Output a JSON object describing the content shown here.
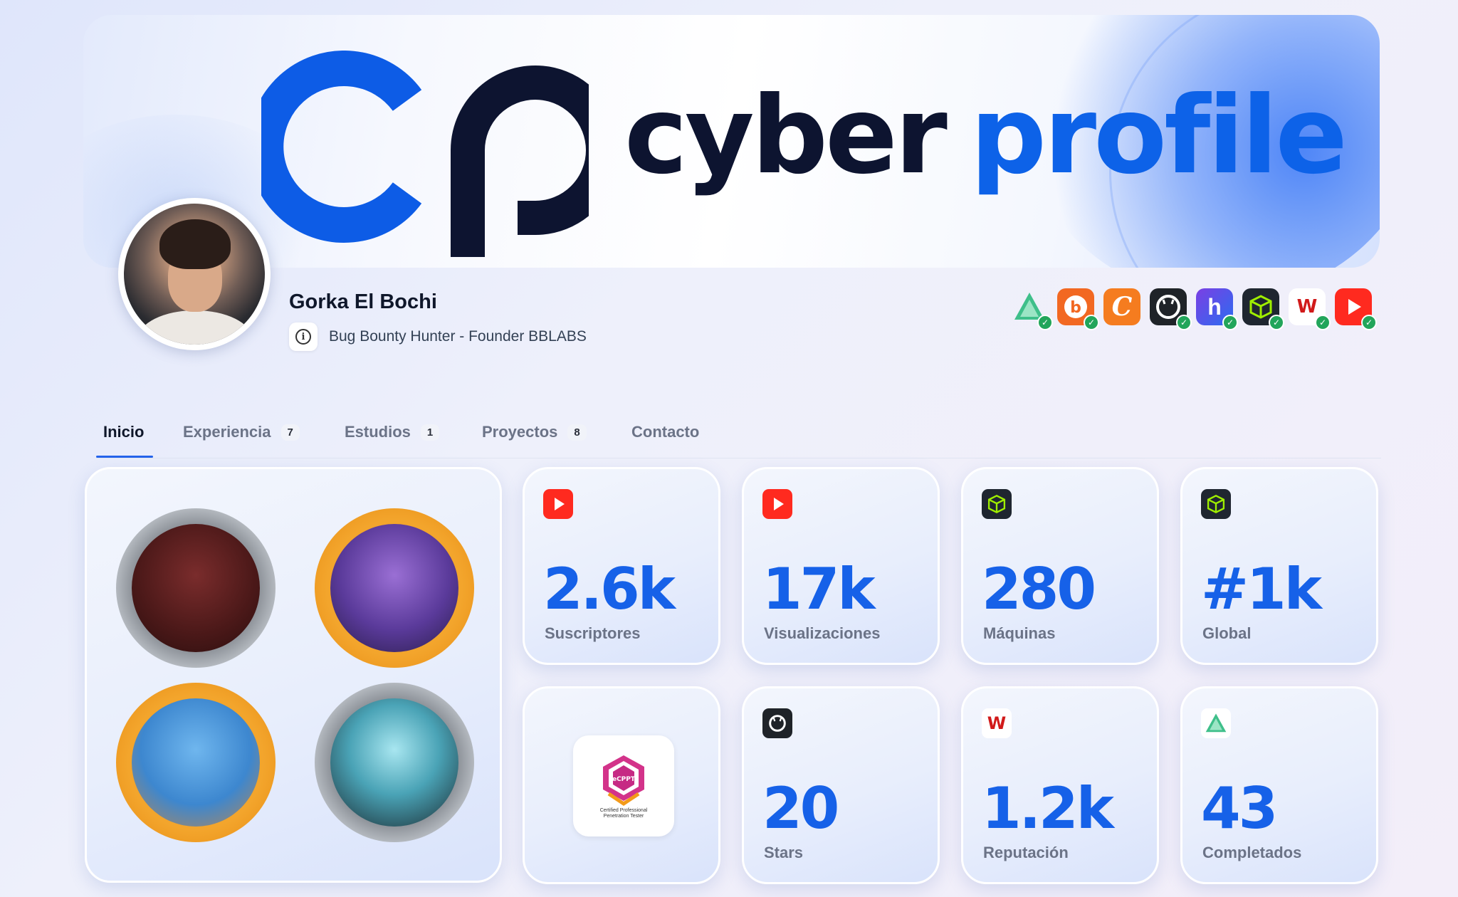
{
  "banner": {
    "word1": "cyber",
    "word2": "profile"
  },
  "user": {
    "name": "Gorka El Bochi",
    "bio": "Bug Bounty Hunter - Founder BBLABS"
  },
  "platforms": [
    {
      "name": "tryhackme-icon",
      "color": "#ffffff"
    },
    {
      "name": "bugcrowd-icon",
      "color": "#f26822"
    },
    {
      "name": "crowdsec-icon",
      "color": "#f57c1f"
    },
    {
      "name": "github-icon",
      "color": "#1f2328"
    },
    {
      "name": "hackerone-icon",
      "color": "#494649"
    },
    {
      "name": "hackthebox-icon",
      "color": "#1f2630"
    },
    {
      "name": "hackmyvm-icon",
      "color": "#ffffff"
    },
    {
      "name": "youtube-icon",
      "color": "#ff2a1f"
    }
  ],
  "tabs": [
    {
      "label": "Inicio",
      "count": ""
    },
    {
      "label": "Experiencia",
      "count": "7"
    },
    {
      "label": "Estudios",
      "count": "1"
    },
    {
      "label": "Proyectos",
      "count": "8"
    },
    {
      "label": "Contacto",
      "count": ""
    }
  ],
  "stats": [
    {
      "value": "2.6k",
      "label": "Suscriptores",
      "icon": "youtube-icon"
    },
    {
      "value": "17k",
      "label": "Visualizaciones",
      "icon": "youtube-icon"
    },
    {
      "value": "280",
      "label": "Máquinas",
      "icon": "hackthebox-icon"
    },
    {
      "value": "#1k",
      "label": "Global",
      "icon": "hackthebox-icon"
    },
    {
      "value": "20",
      "label": "Stars",
      "icon": "github-icon"
    },
    {
      "value": "1.2k",
      "label": "Reputación",
      "icon": "hackmyvm-icon"
    },
    {
      "value": "43",
      "label": "Completados",
      "icon": "tryhackme-icon"
    }
  ],
  "certificate": {
    "abbr": "eCPPT",
    "title_line1": "Certified Professional",
    "title_line2": "Penetration Tester"
  },
  "colors": {
    "accent": "#1661e8",
    "brand_dark": "#0d1430",
    "brand_blue": "#0d62e8"
  }
}
